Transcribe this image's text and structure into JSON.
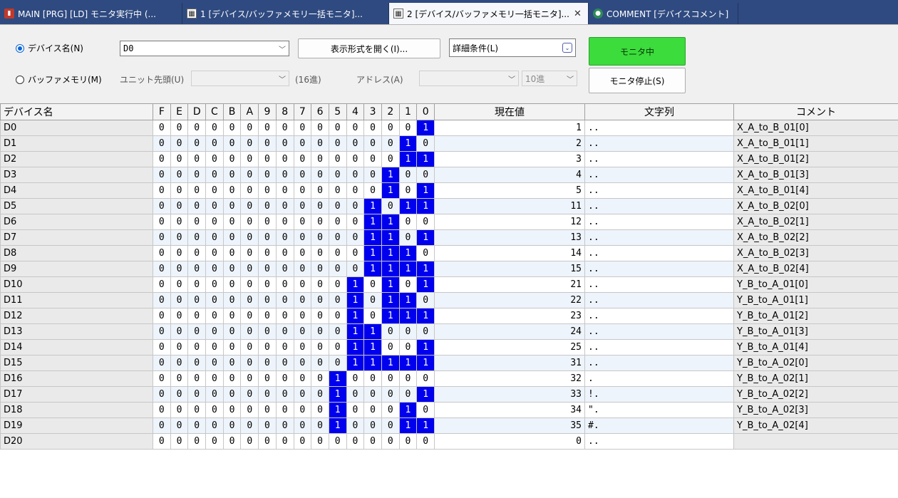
{
  "tabs": [
    {
      "label": "MAIN [PRG] [LD] モニタ実行中 (...",
      "icon": "program-icon",
      "active": false
    },
    {
      "label": "1 [デバイス/バッファメモリ一括モニタ]...",
      "icon": "monitor-icon",
      "active": false
    },
    {
      "label": "2 [デバイス/バッファメモリ一括モニタ]...",
      "icon": "monitor-icon",
      "active": true
    },
    {
      "label": "COMMENT [デバイスコメント]",
      "icon": "comment-icon",
      "active": false
    }
  ],
  "toolbar": {
    "device_radio": "デバイス名(N)",
    "device_value": "D0",
    "buffer_radio": "バッファメモリ(M)",
    "unit_label": "ユニット先頭(U)",
    "unit_suffix": "(16進)",
    "address_label": "アドレス(A)",
    "radix_value": "10進",
    "display_format_button": "表示形式を開く(I)...",
    "detail_combo": "詳細条件(L)",
    "monitoring_button": "モニタ中",
    "stop_button": "モニタ停止(S)"
  },
  "colors": {
    "bit_on": "#0000ee",
    "monitoring_green": "#3bdc3b",
    "tabbar": "#2f4a80"
  },
  "table": {
    "headers": {
      "device": "デバイス名",
      "bits": [
        "F",
        "E",
        "D",
        "C",
        "B",
        "A",
        "9",
        "8",
        "7",
        "6",
        "5",
        "4",
        "3",
        "2",
        "1",
        "0"
      ],
      "current": "現在値",
      "string": "文字列",
      "comment": "コメント"
    },
    "rows": [
      {
        "device": "D0",
        "value": 1,
        "string": "..",
        "comment": "X_A_to_B_01[0]"
      },
      {
        "device": "D1",
        "value": 2,
        "string": "..",
        "comment": "X_A_to_B_01[1]"
      },
      {
        "device": "D2",
        "value": 3,
        "string": "..",
        "comment": "X_A_to_B_01[2]"
      },
      {
        "device": "D3",
        "value": 4,
        "string": "..",
        "comment": "X_A_to_B_01[3]"
      },
      {
        "device": "D4",
        "value": 5,
        "string": "..",
        "comment": "X_A_to_B_01[4]"
      },
      {
        "device": "D5",
        "value": 11,
        "string": "..",
        "comment": "X_A_to_B_02[0]"
      },
      {
        "device": "D6",
        "value": 12,
        "string": "..",
        "comment": "X_A_to_B_02[1]"
      },
      {
        "device": "D7",
        "value": 13,
        "string": "..",
        "comment": "X_A_to_B_02[2]"
      },
      {
        "device": "D8",
        "value": 14,
        "string": "..",
        "comment": "X_A_to_B_02[3]"
      },
      {
        "device": "D9",
        "value": 15,
        "string": "..",
        "comment": "X_A_to_B_02[4]"
      },
      {
        "device": "D10",
        "value": 21,
        "string": "..",
        "comment": "Y_B_to_A_01[0]"
      },
      {
        "device": "D11",
        "value": 22,
        "string": "..",
        "comment": "Y_B_to_A_01[1]"
      },
      {
        "device": "D12",
        "value": 23,
        "string": "..",
        "comment": "Y_B_to_A_01[2]"
      },
      {
        "device": "D13",
        "value": 24,
        "string": "..",
        "comment": "Y_B_to_A_01[3]"
      },
      {
        "device": "D14",
        "value": 25,
        "string": "..",
        "comment": "Y_B_to_A_01[4]"
      },
      {
        "device": "D15",
        "value": 31,
        "string": "..",
        "comment": "Y_B_to_A_02[0]"
      },
      {
        "device": "D16",
        "value": 32,
        "string": " .",
        "comment": "Y_B_to_A_02[1]"
      },
      {
        "device": "D17",
        "value": 33,
        "string": "!.",
        "comment": "Y_B_to_A_02[2]"
      },
      {
        "device": "D18",
        "value": 34,
        "string": "\".",
        "comment": "Y_B_to_A_02[3]"
      },
      {
        "device": "D19",
        "value": 35,
        "string": "#.",
        "comment": "Y_B_to_A_02[4]"
      },
      {
        "device": "D20",
        "value": 0,
        "string": "..",
        "comment": ""
      }
    ]
  }
}
